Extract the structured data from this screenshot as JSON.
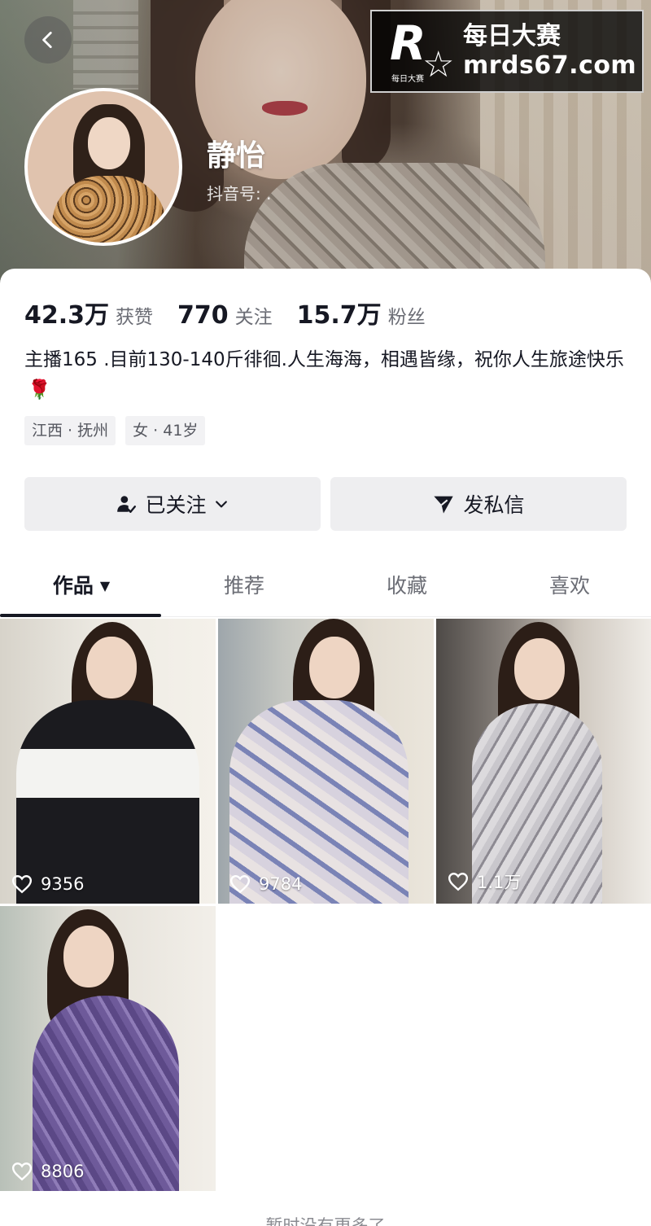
{
  "header": {
    "name": "静怡",
    "douyin_id_label": "抖音号: .",
    "back_icon": "chevron-left-icon"
  },
  "watermark": {
    "logo_letter": "R",
    "logo_small_text": "每日大赛",
    "title": "每日大赛",
    "url": "mrds67.com"
  },
  "stats": [
    {
      "value": "42.3万",
      "label": "获赞"
    },
    {
      "value": "770",
      "label": "关注"
    },
    {
      "value": "15.7万",
      "label": "粉丝"
    }
  ],
  "bio": {
    "text": "主播165 .目前130-140斤徘徊.人生海海，相遇皆缘，祝你人生旅途快乐",
    "emoji": "🌹"
  },
  "tags": [
    "江西 · 抚州",
    "女 · 41岁"
  ],
  "actions": {
    "follow_label": "已关注",
    "message_label": "发私信"
  },
  "tabs": [
    {
      "label": "作品",
      "active": true
    },
    {
      "label": "推荐",
      "active": false
    },
    {
      "label": "收藏",
      "active": false
    },
    {
      "label": "喜欢",
      "active": false
    }
  ],
  "videos": [
    {
      "likes": "9356"
    },
    {
      "likes": "9784"
    },
    {
      "likes": "1.1万"
    },
    {
      "likes": "8806"
    }
  ],
  "footer": {
    "end_text": "暂时没有更多了"
  },
  "colors": {
    "text_primary": "#161823",
    "text_secondary": "#6b6d75",
    "button_bg": "#eeeef0",
    "background": "#ffffff"
  }
}
